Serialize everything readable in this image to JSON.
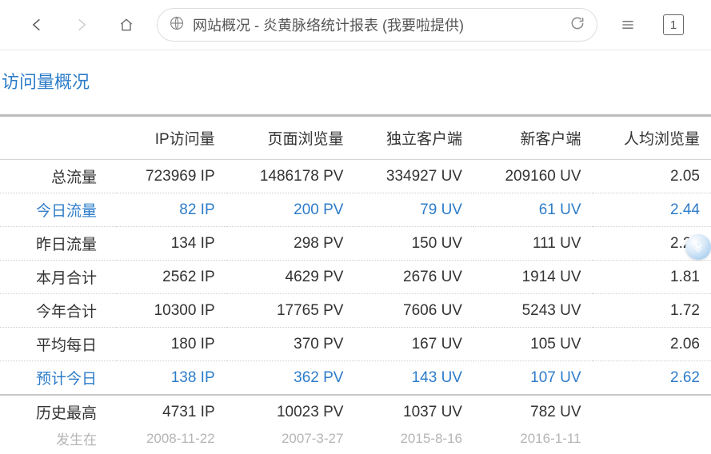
{
  "browser": {
    "page_title": "网站概况 - 炎黄脉络统计报表 (我要啦提供)",
    "tab_count": "1"
  },
  "section_title": "访问量概况",
  "table": {
    "headers": [
      "",
      "IP访问量",
      "页面浏览量",
      "独立客户端",
      "新客户端",
      "人均浏览量"
    ],
    "rows": [
      {
        "label": "总流量",
        "cells": [
          "723969 IP",
          "1486178 PV",
          "334927 UV",
          "209160 UV",
          "2.05"
        ],
        "link": false
      },
      {
        "label": "今日流量",
        "cells": [
          "82 IP",
          "200 PV",
          "79 UV",
          "61 UV",
          "2.44"
        ],
        "link": true
      },
      {
        "label": "昨日流量",
        "cells": [
          "134 IP",
          "298 PV",
          "150 UV",
          "111 UV",
          "2.22"
        ],
        "link": false
      },
      {
        "label": "本月合计",
        "cells": [
          "2562 IP",
          "4629 PV",
          "2676 UV",
          "1914 UV",
          "1.81"
        ],
        "link": false
      },
      {
        "label": "今年合计",
        "cells": [
          "10300 IP",
          "17765 PV",
          "7606 UV",
          "5243 UV",
          "1.72"
        ],
        "link": false
      },
      {
        "label": "平均每日",
        "cells": [
          "180 IP",
          "370 PV",
          "167 UV",
          "105 UV",
          "2.06"
        ],
        "link": false
      },
      {
        "label": "预计今日",
        "cells": [
          "138 IP",
          "362 PV",
          "143 UV",
          "107 UV",
          "2.62"
        ],
        "link": true
      }
    ],
    "history": {
      "label": "历史最高",
      "cells": [
        "4731 IP",
        "10023 PV",
        "1037 UV",
        "782 UV",
        ""
      ],
      "sub_label": "发生在",
      "sub_cells": [
        "2008-11-22",
        "2007-3-27",
        "2015-8-16",
        "2016-1-11",
        ""
      ]
    }
  }
}
